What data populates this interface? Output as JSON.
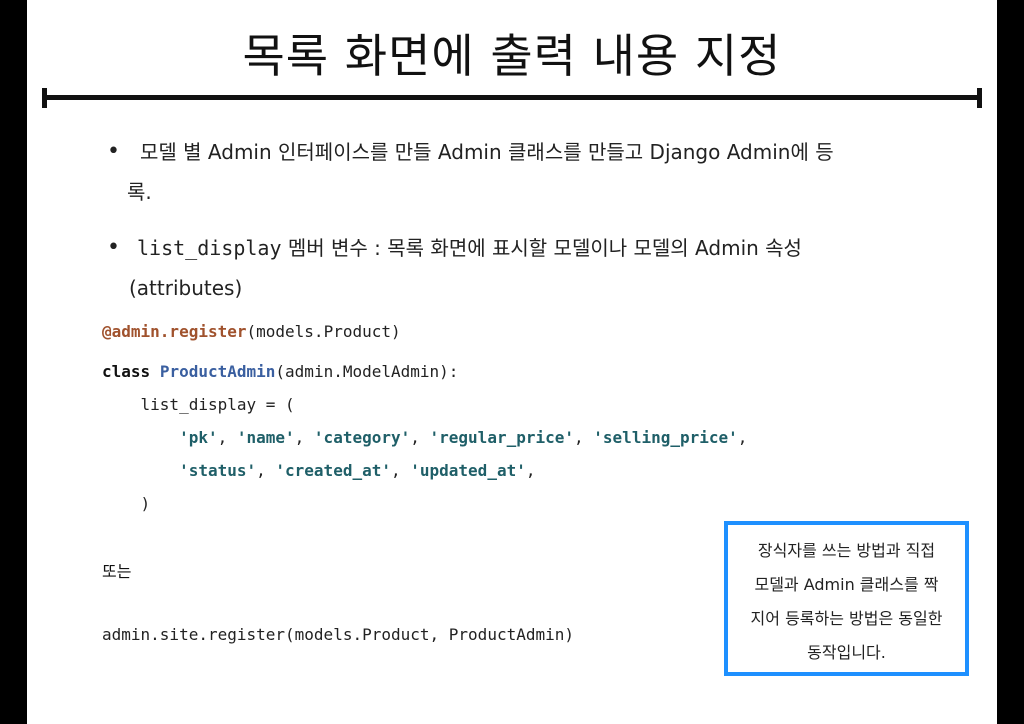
{
  "title": "목록 화면에 출력 내용 지정",
  "bullets": [
    {
      "line1": "모델 별 Admin 인터페이스를 만들 Admin 클래스를 만들고 Django Admin에 등",
      "line2": "록."
    },
    {
      "code": "list_display",
      "line1_rest": " 멤버 변수 : 목록 화면에 표시할 모델이나 모델의 Admin 속성",
      "line2": "(attributes)"
    }
  ],
  "code": {
    "decorator": "@admin.register",
    "decorator_args": "(models.Product)",
    "kw_class": "class",
    "class_name": "ProductAdmin",
    "class_base": "(admin.ModelAdmin):",
    "list_display_line": "    list_display = (",
    "fields_row1": [
      "'pk'",
      "'name'",
      "'category'",
      "'regular_price'",
      "'selling_price'"
    ],
    "fields_row2": [
      "'status'",
      "'created_at'",
      "'updated_at'"
    ],
    "close_paren": "    )",
    "or_label": "또는",
    "site_register": "admin.site.register(models.Product, ProductAdmin)"
  },
  "note": {
    "lines": [
      "장식자를 쓰는 방법과 직접",
      "모델과 Admin 클래스를 짝",
      "지어 등록하는 방법은 동일한",
      "동작입니다."
    ]
  },
  "colors": {
    "decorator": "#a0522d",
    "class_name": "#3a5fa0",
    "string": "#1f5f68",
    "note_border": "#1e90ff"
  }
}
